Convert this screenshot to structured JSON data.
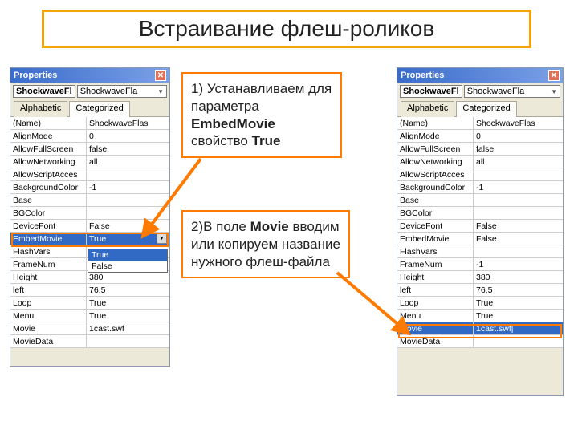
{
  "title": "Встраивание флеш-роликов",
  "callout1_pre": "1) Устанавливаем для параметра ",
  "callout1_b1": "EmbedMovie",
  "callout1_mid": " свойство ",
  "callout1_b2": "True",
  "callout2_pre": "2)В поле ",
  "callout2_b1": "Movie",
  "callout2_post": " вводим или копируем название нужного флеш-файла",
  "panel": {
    "title": "Properties",
    "obj_name": "ShockwaveFl",
    "obj_type": "ShockwaveFla",
    "tab_alpha": "Alphabetic",
    "tab_cat": "Categorized"
  },
  "left_rows": [
    {
      "k": "(Name)",
      "v": "ShockwaveFlas"
    },
    {
      "k": "AlignMode",
      "v": "0"
    },
    {
      "k": "AllowFullScreen",
      "v": "false"
    },
    {
      "k": "AllowNetworking",
      "v": "all"
    },
    {
      "k": "AllowScriptAcces",
      "v": ""
    },
    {
      "k": "BackgroundColor",
      "v": "-1"
    },
    {
      "k": "Base",
      "v": ""
    },
    {
      "k": "BGColor",
      "v": ""
    },
    {
      "k": "DeviceFont",
      "v": "False"
    },
    {
      "k": "EmbedMovie",
      "v": "True",
      "selected": true,
      "dd": true
    },
    {
      "k": "FlashVars",
      "v": ""
    },
    {
      "k": "FrameNum",
      "v": ""
    },
    {
      "k": "Height",
      "v": "380"
    },
    {
      "k": "left",
      "v": "76,5"
    },
    {
      "k": "Loop",
      "v": "True"
    },
    {
      "k": "Menu",
      "v": "True"
    },
    {
      "k": "Movie",
      "v": "1cast.swf"
    },
    {
      "k": "MovieData",
      "v": ""
    }
  ],
  "dd_options": [
    "True",
    "False"
  ],
  "right_rows": [
    {
      "k": "(Name)",
      "v": "ShockwaveFlas"
    },
    {
      "k": "AlignMode",
      "v": "0"
    },
    {
      "k": "AllowFullScreen",
      "v": "false"
    },
    {
      "k": "AllowNetworking",
      "v": "all"
    },
    {
      "k": "AllowScriptAcces",
      "v": ""
    },
    {
      "k": "BackgroundColor",
      "v": "-1"
    },
    {
      "k": "Base",
      "v": ""
    },
    {
      "k": "BGColor",
      "v": ""
    },
    {
      "k": "DeviceFont",
      "v": "False"
    },
    {
      "k": "EmbedMovie",
      "v": "False"
    },
    {
      "k": "FlashVars",
      "v": ""
    },
    {
      "k": "FrameNum",
      "v": "-1"
    },
    {
      "k": "Height",
      "v": "380"
    },
    {
      "k": "left",
      "v": "76,5"
    },
    {
      "k": "Loop",
      "v": "True"
    },
    {
      "k": "Menu",
      "v": "True"
    },
    {
      "k": "Movie",
      "v": "1cast.swf|",
      "selected": true
    },
    {
      "k": "MovieData",
      "v": ""
    }
  ]
}
